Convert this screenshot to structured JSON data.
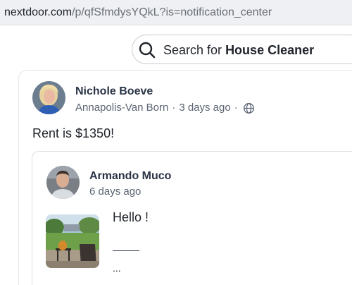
{
  "browser": {
    "url_host": "nextdoor.com",
    "url_rest": "/p/qfSfmdysYQkL?is=notification_center"
  },
  "search": {
    "prefix": "Search for",
    "term": "House Cleaner",
    "icon": "search-icon"
  },
  "post": {
    "author": "Nichole Boeve",
    "neighborhood": "Annapolis-Van Born",
    "separator": "·",
    "time": "3 days ago",
    "visibility_icon": "globe-icon",
    "body": "Rent is $1350!"
  },
  "shared_post": {
    "author": "Armando Muco",
    "time": "6 days ago",
    "body": "Hello !",
    "ellipsis": "..."
  },
  "colors": {
    "text": "#1f232a",
    "muted": "#5b6472",
    "border": "#dcdfe4",
    "urlbar": "#eef0f3"
  }
}
